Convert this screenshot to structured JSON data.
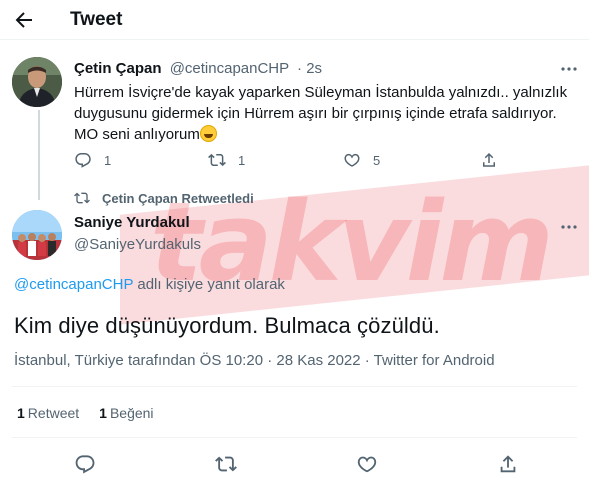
{
  "header": {
    "title": "Tweet"
  },
  "quoted_tweet": {
    "name": "Çetin Çapan",
    "handle": "@cetincapanCHP",
    "time": "· 2s",
    "text": "Hürrem İsviçre'de kayak yaparken Süleyman İstanbulda yalnızdı..  yalnızlık duygusunu gidermek için Hürrem aşırı bir çırpınış içinde etrafa saldırıyor. MO seni anlıyorum",
    "replies": "1",
    "retweets": "1",
    "likes": "5"
  },
  "retweet_notice": "Çetin Çapan Retweetledi",
  "main_tweet": {
    "name": "Saniye Yurdakul",
    "handle": "@SaniyeYurdakuls",
    "reply_to_handle": "@cetincapanCHP",
    "reply_to_suffix": " adlı kişiye yanıt olarak",
    "text": "Kim diye düşünüyordum.  Bulmaca çözüldü.",
    "meta": "İstanbul, Türkiye tarafından ÖS 10:20 · 28 Kas 2022 · Twitter for Android"
  },
  "stats": {
    "retweets_count": "1",
    "retweets_label": "Retweet",
    "likes_count": "1",
    "likes_label": "Beğeni"
  },
  "watermark": {
    "text": "takvim",
    "color": "#e83238"
  },
  "colors": {
    "link": "#1d9bf0",
    "muted": "#536471",
    "text": "#0f1419"
  }
}
